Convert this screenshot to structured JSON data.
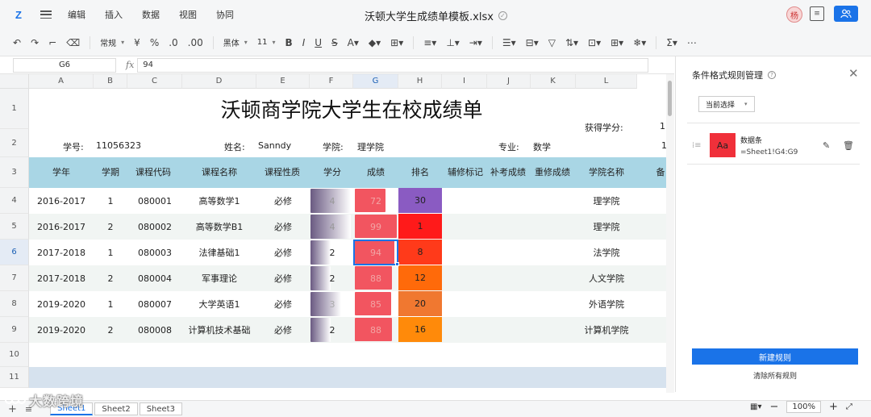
{
  "app": {
    "logo": "Z",
    "menu": [
      "编辑",
      "插入",
      "数据",
      "视图",
      "协同"
    ],
    "filename": "沃顿大学生成绩单模板.xlsx",
    "avatar_text": "杨"
  },
  "toolbar": {
    "format_select": "常规",
    "font_select": "黑体",
    "size_select": "11",
    "currency": "¥",
    "percent": "%",
    "sum": "Σ"
  },
  "formula_bar": {
    "cell_ref": "G6",
    "fx": "fx",
    "value": "94"
  },
  "columns": [
    "A",
    "B",
    "C",
    "D",
    "E",
    "F",
    "G",
    "H",
    "I",
    "J",
    "K",
    "L"
  ],
  "rows": [
    "1",
    "2",
    "3",
    "4",
    "5",
    "6",
    "7",
    "8",
    "9",
    "10",
    "11"
  ],
  "sheet": {
    "title": "沃顿商学院大学生在校成绩单",
    "credit_label": "获得学分:",
    "credit_value": "1",
    "student_id_label": "学号:",
    "student_id": "11056323",
    "name_label": "姓名:",
    "name": "Sanndy",
    "college_label": "学院:",
    "college": "理学院",
    "major_label": "专业:",
    "major": "数学",
    "col_m_row2": "1",
    "headers": {
      "year": "学年",
      "term": "学期",
      "code": "课程代码",
      "course": "课程名称",
      "nature": "课程性质",
      "credit": "学分",
      "score": "成绩",
      "rank": "排名",
      "retake": "辅修标记",
      "makeup": "补考成绩",
      "repeat": "重修成绩",
      "college": "学院名称",
      "note": "备"
    },
    "records": [
      {
        "year": "2016-2017",
        "term": "1",
        "code": "080001",
        "course": "高等数学1",
        "nature": "必修",
        "credit": "4",
        "score": "72",
        "rank": "30",
        "college": "理学院"
      },
      {
        "year": "2016-2017",
        "term": "2",
        "code": "080002",
        "course": "高等数学B1",
        "nature": "必修",
        "credit": "4",
        "score": "99",
        "rank": "1",
        "college": "理学院"
      },
      {
        "year": "2017-2018",
        "term": "1",
        "code": "080003",
        "course": "法律基础1",
        "nature": "必修",
        "credit": "2",
        "score": "94",
        "rank": "8",
        "college": "法学院"
      },
      {
        "year": "2017-2018",
        "term": "2",
        "code": "080004",
        "course": "军事理论",
        "nature": "必修",
        "credit": "2",
        "score": "88",
        "rank": "12",
        "college": "人文学院"
      },
      {
        "year": "2019-2020",
        "term": "1",
        "code": "080007",
        "course": "大学英语1",
        "nature": "必修",
        "credit": "3",
        "score": "85",
        "rank": "20",
        "college": "外语学院"
      },
      {
        "year": "2019-2020",
        "term": "2",
        "code": "080008",
        "course": "计算机技术基础",
        "nature": "必修",
        "credit": "2",
        "score": "88",
        "rank": "16",
        "college": "计算机学院"
      }
    ],
    "rank_colors": [
      "#8a5bc2",
      "#ff1a1a",
      "#ff3a1a",
      "#ff6a0a",
      "#f07830",
      "#ff8a0a"
    ]
  },
  "sheets": [
    "Sheet1",
    "Sheet2",
    "Sheet3"
  ],
  "watermark": "大数跨境",
  "zoom": "100%",
  "panel": {
    "title": "条件格式规则管理",
    "scope": "当前选择",
    "rule_preview": "Aa",
    "rule_name": "数据条",
    "rule_range": "=Sheet1!G4:G9",
    "new_rule": "新建规则",
    "clear_rules": "清除所有规则"
  }
}
